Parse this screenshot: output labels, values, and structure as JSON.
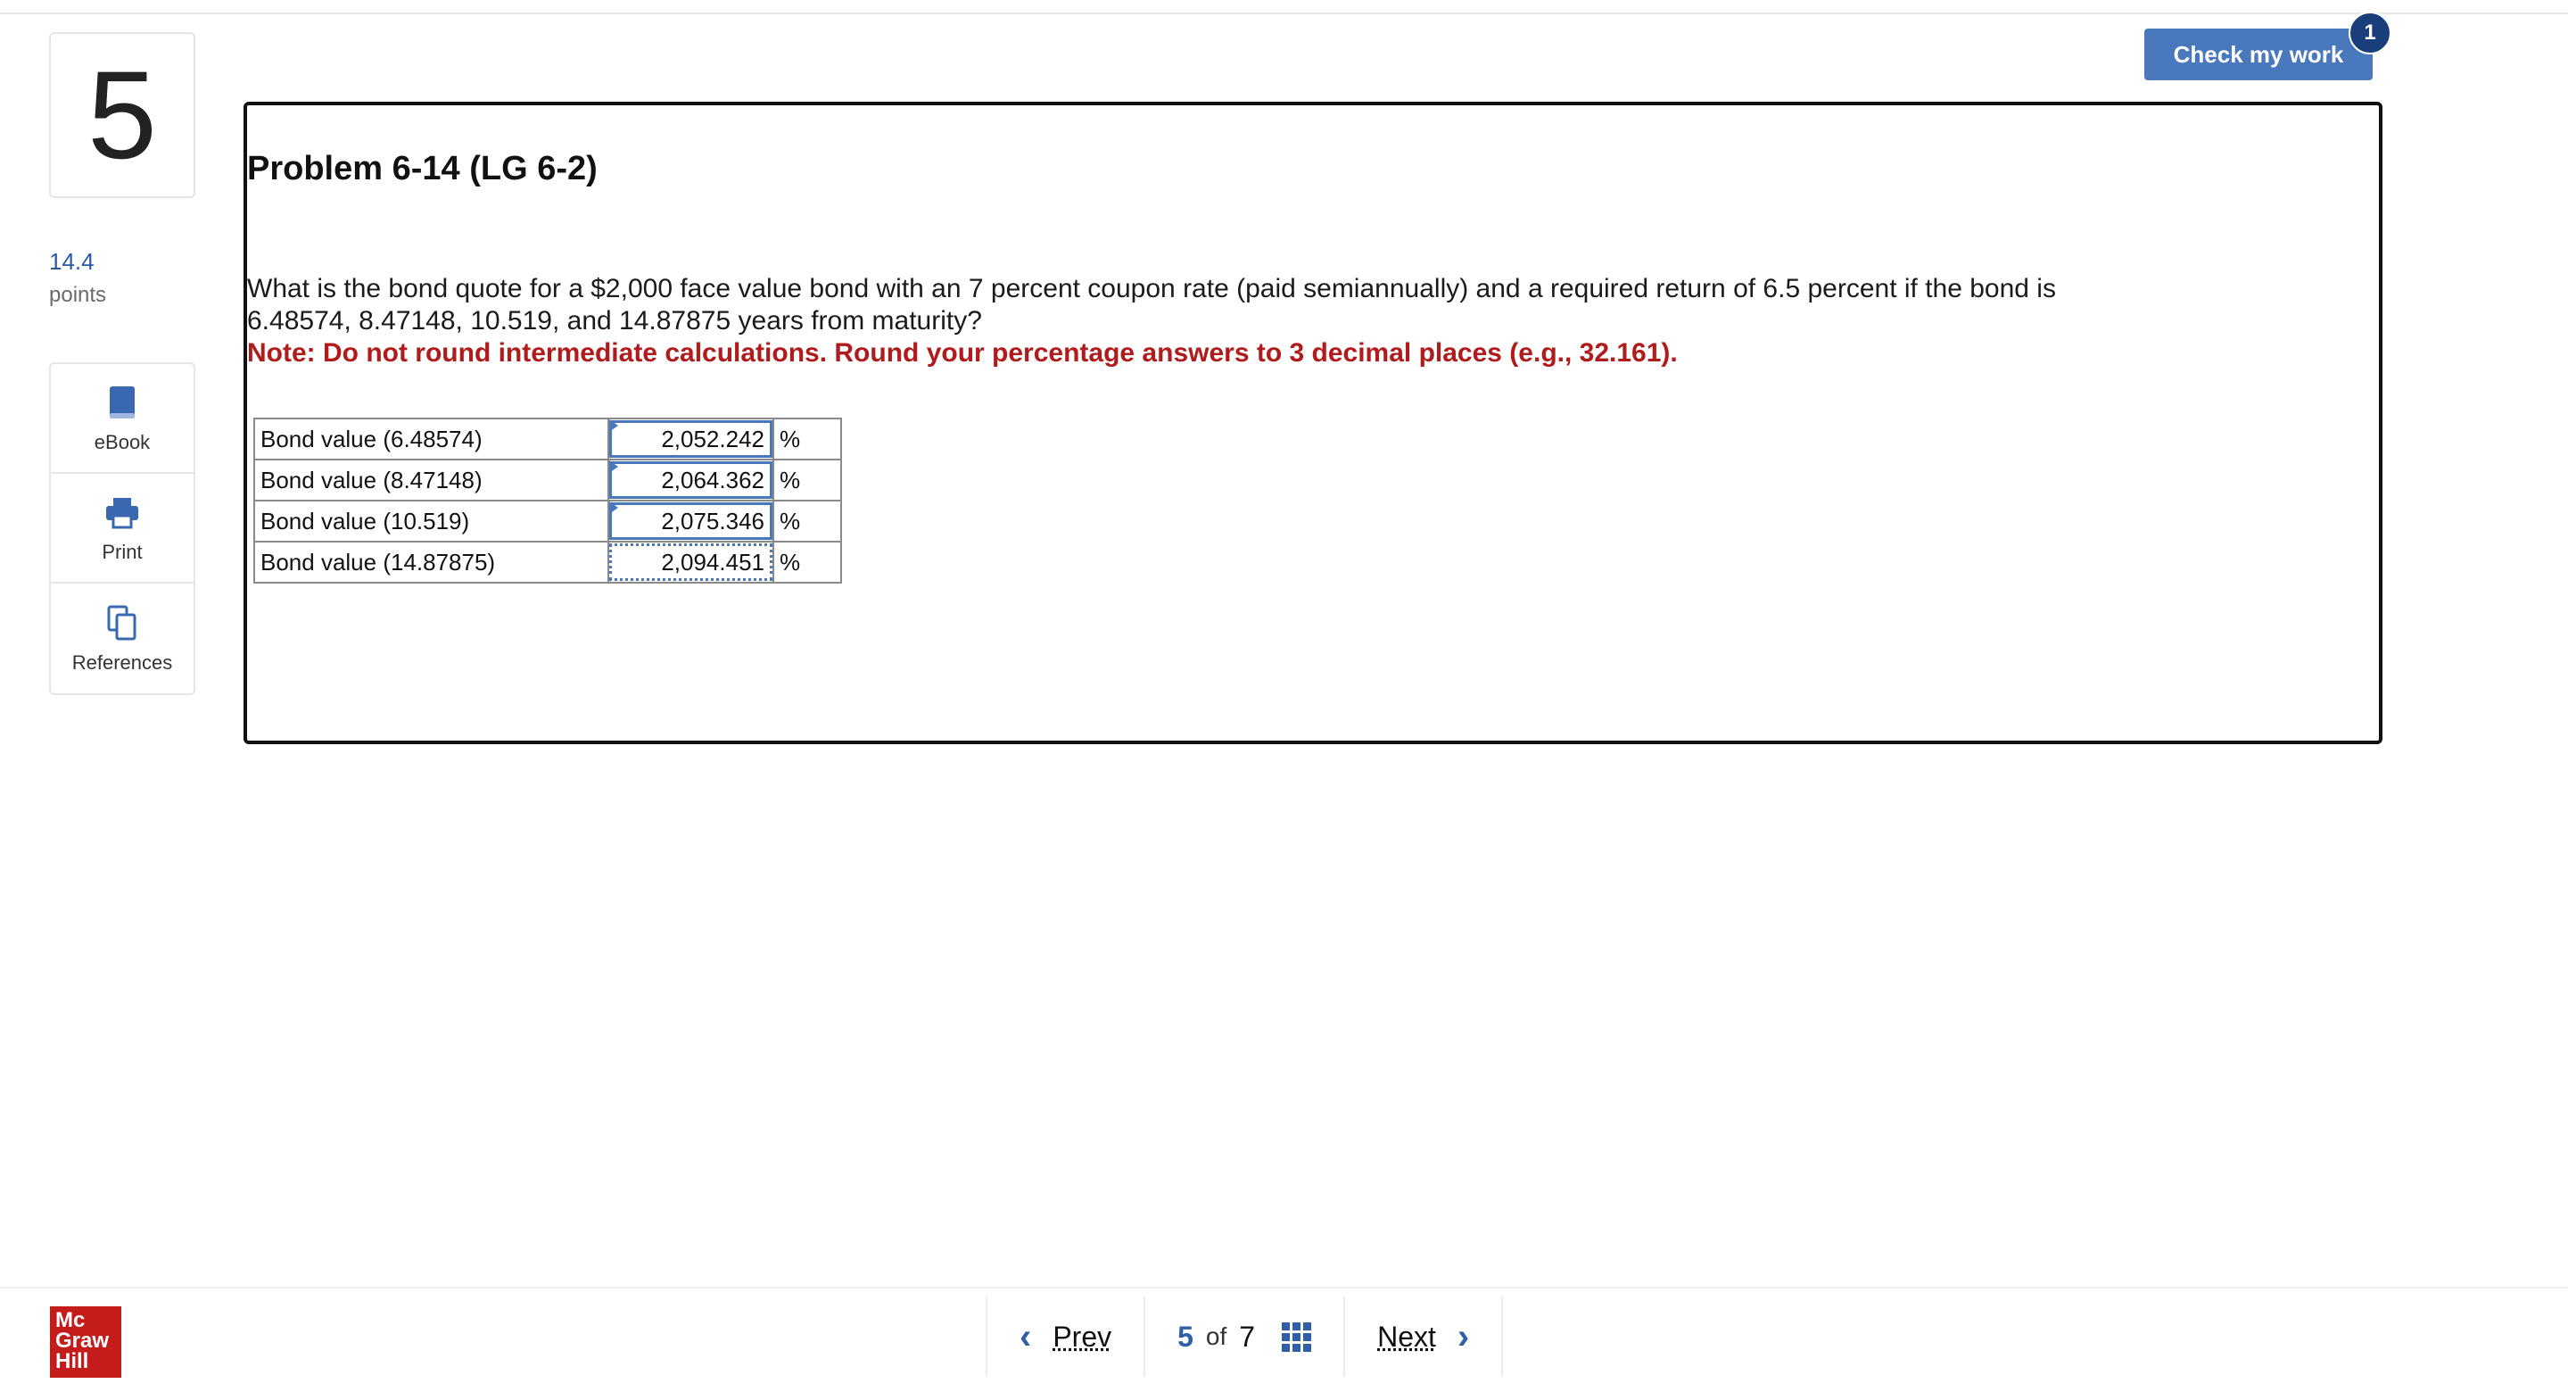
{
  "question": {
    "number": "5",
    "points_value": "14.4",
    "points_label": "points"
  },
  "tools": [
    {
      "label": "eBook",
      "icon": "book-icon"
    },
    {
      "label": "Print",
      "icon": "printer-icon"
    },
    {
      "label": "References",
      "icon": "copy-icon"
    }
  ],
  "check": {
    "label": "Check my work",
    "badge": "1"
  },
  "problem": {
    "title": "Problem 6-14 (LG 6-2)",
    "text": "What is the bond quote for a $2,000 face value bond with an 7 percent coupon rate (paid semiannually) and a required return of 6.5 percent if the bond is 6.48574, 8.47148, 10.519, and 14.87875 years from maturity?",
    "note": "Note: Do not round intermediate calculations. Round your percentage answers to 3 decimal places (e.g., 32.161).",
    "rows": [
      {
        "label": "Bond value (6.48574)",
        "value": "2,052.242",
        "unit": "%"
      },
      {
        "label": "Bond value (8.47148)",
        "value": "2,064.362",
        "unit": "%"
      },
      {
        "label": "Bond value (10.519)",
        "value": "2,075.346",
        "unit": "%"
      },
      {
        "label": "Bond value (14.87875)",
        "value": "2,094.451",
        "unit": "%"
      }
    ]
  },
  "footer": {
    "logo": [
      "Mc",
      "Graw",
      "Hill"
    ],
    "prev": "Prev",
    "next": "Next",
    "current": "5",
    "of": "of",
    "total": "7"
  },
  "colors": {
    "accent": "#4a78bd",
    "badge": "#1a3d7c",
    "note": "#b01b1b",
    "logo": "#c41b1b"
  }
}
